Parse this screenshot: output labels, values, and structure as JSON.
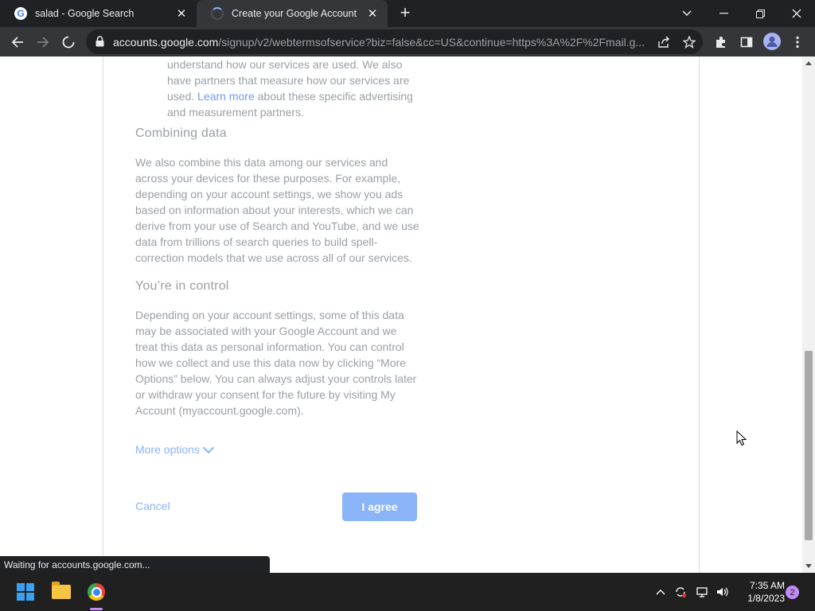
{
  "tabs": [
    {
      "title": "salad - Google Search",
      "favicon": "google-g-icon",
      "active": false
    },
    {
      "title": "Create your Google Account",
      "favicon": "loading-spinner-icon",
      "active": true
    }
  ],
  "window_controls": {
    "tab_search": "⌄",
    "minimize": "–",
    "restore": "❐",
    "close": "✕"
  },
  "address_bar": {
    "host": "accounts.google.com",
    "path": "/signup/v2/webtermsofservice?biz=false&cc=US&continue=https%3A%2F%2Fmail.g..."
  },
  "content": {
    "partners_text_before_link": "understand how our services are used. We also have partners that measure how our services are used. ",
    "learn_more": "Learn more",
    "partners_text_after_link": " about these specific advertising and measurement partners.",
    "combining_heading": "Combining data",
    "combining_text": "We also combine this data among our services and across your devices for these purposes. For example, depending on your account settings, we show you ads based on information about your interests, which we can derive from your use of Search and YouTube, and we use data from trillions of search queries to build spell-correction models that we use across all of our services.",
    "control_heading": "You’re in control",
    "control_text": "Depending on your account settings, some of this data may be associated with your Google Account and we treat this data as personal information. You can control how we collect and use this data now by clicking “More Options” below. You can always adjust your controls later or withdraw your consent for the future by visiting My Account (myaccount.google.com).",
    "more_options": "More options",
    "cancel": "Cancel",
    "agree": "I agree"
  },
  "status_bar": "Waiting for accounts.google.com...",
  "taskbar": {
    "time": "7:35 AM",
    "date": "1/8/2023",
    "notification_count": "2"
  },
  "colors": {
    "accent": "#8ab4f8",
    "text_muted": "#9aa0a6",
    "chrome_dark": "#202124",
    "chrome_toolbar": "#35363a"
  }
}
